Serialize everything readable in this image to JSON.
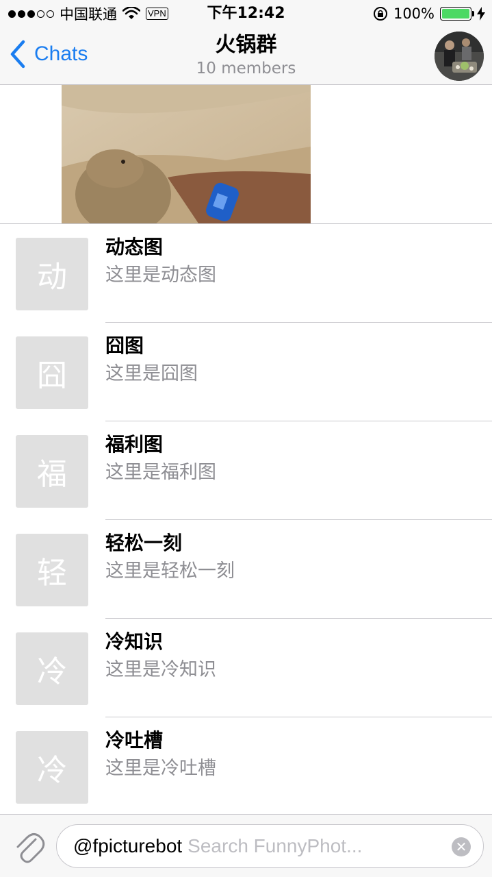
{
  "status_bar": {
    "carrier": "中国联通",
    "vpn": "VPN",
    "time": "下午12:42",
    "battery_percent": "100%",
    "battery_level": 1.0,
    "signal_bars_filled": 3,
    "signal_bars_total": 5
  },
  "nav": {
    "back_label": "Chats",
    "title": "火锅群",
    "subtitle": "10 members",
    "accent_color": "#1a7df0"
  },
  "list": {
    "items": [
      {
        "thumb_char": "动",
        "title": "动态图",
        "subtitle": "这里是动态图"
      },
      {
        "thumb_char": "囧",
        "title": "囧图",
        "subtitle": "这里是囧图"
      },
      {
        "thumb_char": "福",
        "title": "福利图",
        "subtitle": "这里是福利图"
      },
      {
        "thumb_char": "轻",
        "title": "轻松一刻",
        "subtitle": "这里是轻松一刻"
      },
      {
        "thumb_char": "冷",
        "title": "冷知识",
        "subtitle": "这里是冷知识"
      },
      {
        "thumb_char": "冷",
        "title": "冷吐槽",
        "subtitle": "这里是冷吐槽"
      }
    ]
  },
  "input": {
    "value": "@fpicturebot",
    "placeholder": "Search FunnyPhot..."
  }
}
